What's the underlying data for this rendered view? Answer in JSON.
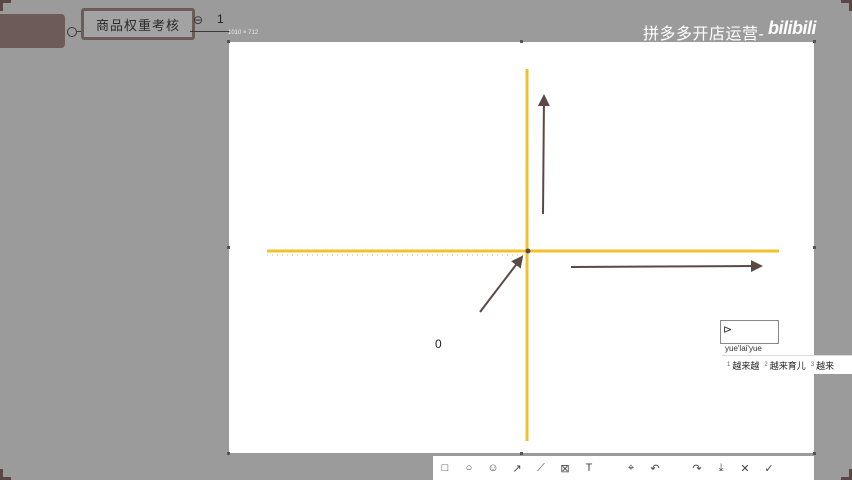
{
  "header": {
    "title_node": "商品权重考核",
    "collapse_icon": "link-icon",
    "count": "1",
    "canvas_size_label": "1010 × 712"
  },
  "watermark": {
    "text": "拼多多开店运营-",
    "brand": "bilibili"
  },
  "canvas": {
    "origin_label": "0",
    "axis_color": "#f2c12e",
    "arrow_color": "#5a4a46"
  },
  "ime": {
    "pinyin": "yue'lai'yue",
    "candidates": [
      {
        "num": "1",
        "text": "越来越"
      },
      {
        "num": "2",
        "text": "越来育儿"
      },
      {
        "num": "3",
        "text": "越来"
      }
    ]
  },
  "toolbar": {
    "tools": [
      {
        "name": "rectangle-tool",
        "icon": "□"
      },
      {
        "name": "ellipse-tool",
        "icon": "○"
      },
      {
        "name": "emoji-tool",
        "icon": "☺"
      },
      {
        "name": "arrow-tool",
        "icon": "↗"
      },
      {
        "name": "pen-tool",
        "icon": "⟋"
      },
      {
        "name": "mosaic-tool",
        "icon": "⊠"
      },
      {
        "name": "text-tool",
        "icon": "T"
      },
      {
        "name": "pin-tool",
        "icon": "⌖"
      },
      {
        "name": "undo-tool",
        "icon": "↶"
      },
      {
        "name": "share-tool",
        "icon": "↷"
      },
      {
        "name": "save-tool",
        "icon": "⤓"
      },
      {
        "name": "close-tool",
        "icon": "✕"
      },
      {
        "name": "confirm-tool",
        "icon": "✓"
      }
    ]
  }
}
